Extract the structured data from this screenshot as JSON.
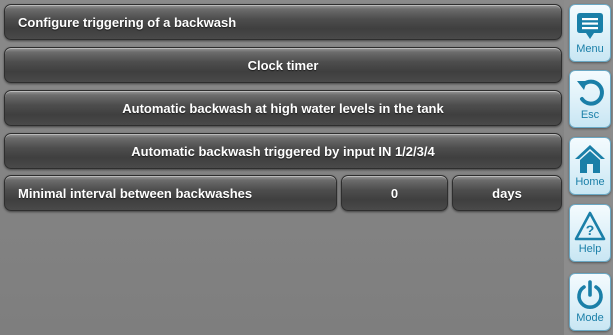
{
  "header": {
    "title": "Configure triggering of a backwash"
  },
  "options": [
    {
      "label": "Clock timer"
    },
    {
      "label": "Automatic backwash at high water levels in the tank"
    },
    {
      "label": "Automatic backwash triggered by input IN 1/2/3/4"
    }
  ],
  "interval": {
    "label": "Minimal interval between backwashes",
    "value": "0",
    "unit": "days"
  },
  "sidebar": {
    "menu": {
      "label": "Menu",
      "icon": "menu-icon"
    },
    "esc": {
      "label": "Esc",
      "icon": "back-arrow-icon"
    },
    "home": {
      "label": "Home",
      "icon": "home-icon"
    },
    "help": {
      "label": "Help",
      "icon": "help-icon"
    },
    "mode": {
      "label": "Mode",
      "icon": "power-icon"
    }
  },
  "colors": {
    "accent": "#1a7fa8",
    "bar": "#454545",
    "background": "#808080"
  }
}
